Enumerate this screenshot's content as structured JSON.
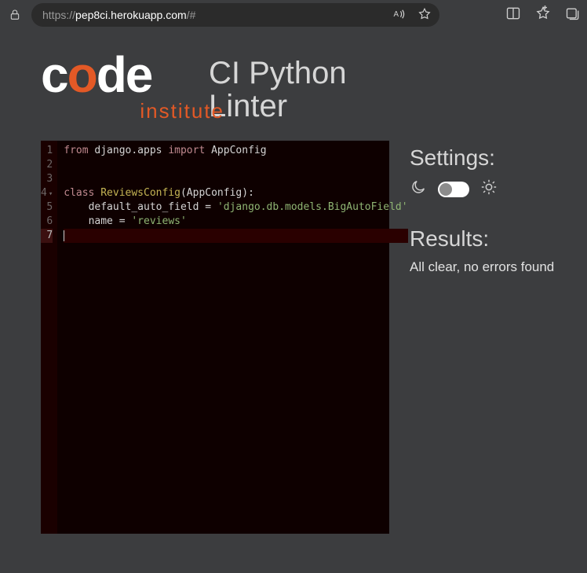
{
  "browser": {
    "url_host": "pep8ci.herokuapp.com",
    "url_prefix": "https://",
    "url_suffix": "/#"
  },
  "logo": {
    "word_c": "c",
    "word_o": "o",
    "word_de": "de",
    "institute": "institute"
  },
  "title": {
    "line1": "CI Python",
    "line2": "Linter"
  },
  "editor": {
    "lines": [
      {
        "n": "1"
      },
      {
        "n": "2"
      },
      {
        "n": "3"
      },
      {
        "n": "4",
        "fold": true
      },
      {
        "n": "5"
      },
      {
        "n": "6"
      },
      {
        "n": "7",
        "active": true
      }
    ],
    "code": {
      "l1": {
        "from": "from",
        "mod": "django.apps",
        "import": "import",
        "name": "AppConfig"
      },
      "l4": {
        "class": "class",
        "name": "ReviewsConfig",
        "base": "AppConfig"
      },
      "l5": {
        "indent": "    ",
        "lhs": "default_auto_field",
        "eq": " = ",
        "rhs": "'django.db.models.BigAutoField'"
      },
      "l6": {
        "indent": "    ",
        "lhs": "name",
        "eq": " = ",
        "rhs": "'reviews'"
      }
    }
  },
  "sidebar": {
    "settings_label": "Settings:",
    "results_label": "Results:",
    "results_msg": "All clear, no errors found"
  }
}
